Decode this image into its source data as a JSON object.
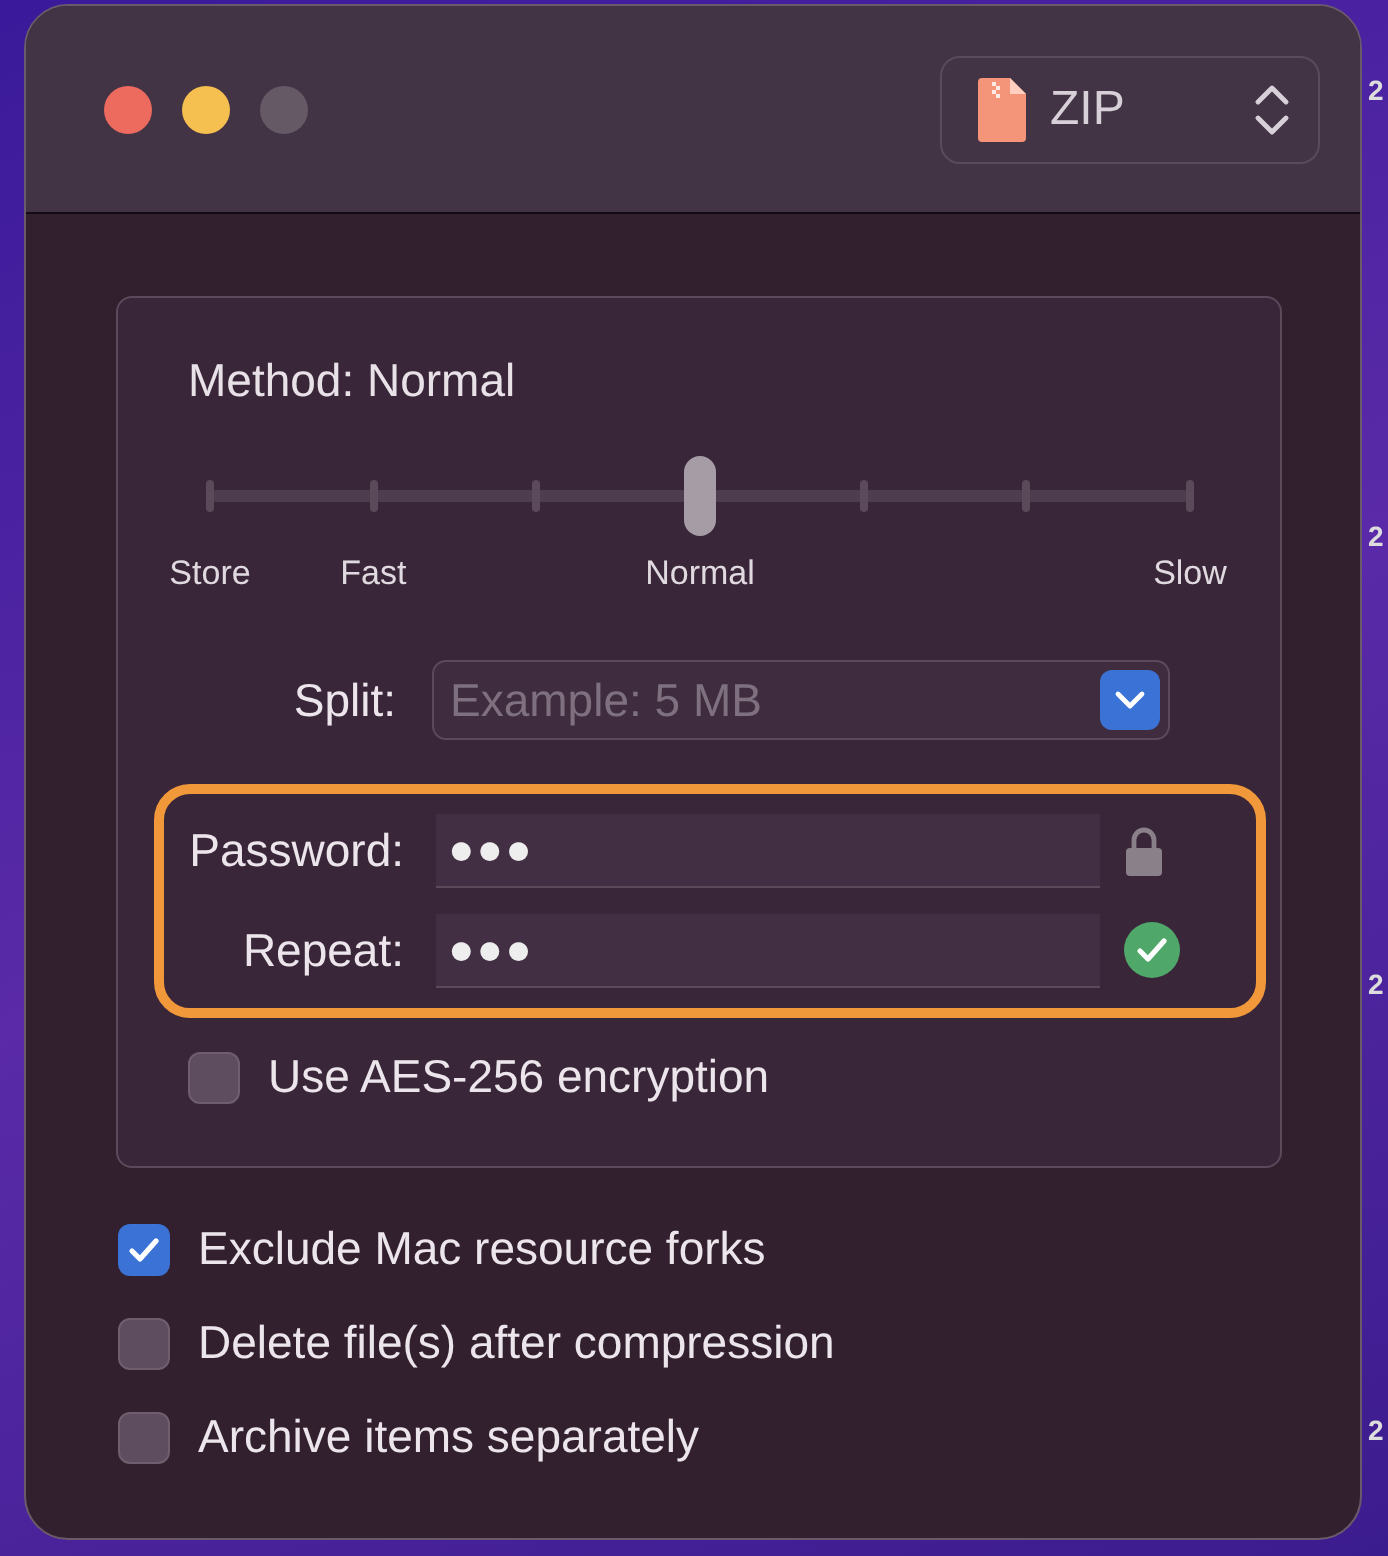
{
  "format_popup": {
    "value": "ZIP"
  },
  "method": {
    "label": "Method: Normal",
    "level": 0.5,
    "tick_labels": [
      "Store",
      "Fast",
      "Normal",
      "Slow"
    ]
  },
  "split": {
    "label": "Split:",
    "placeholder": "Example: 5 MB"
  },
  "password": {
    "label": "Password:",
    "value": "●●●"
  },
  "repeat": {
    "label": "Repeat:",
    "value": "●●●",
    "matched": true
  },
  "aes": {
    "label": "Use AES-256 encryption",
    "checked": false
  },
  "options": [
    {
      "label": "Exclude Mac resource forks",
      "checked": true
    },
    {
      "label": "Delete file(s) after compression",
      "checked": false
    },
    {
      "label": "Archive items separately",
      "checked": false
    }
  ],
  "desktop_labels": [
    "2",
    "2",
    "2",
    "2"
  ]
}
